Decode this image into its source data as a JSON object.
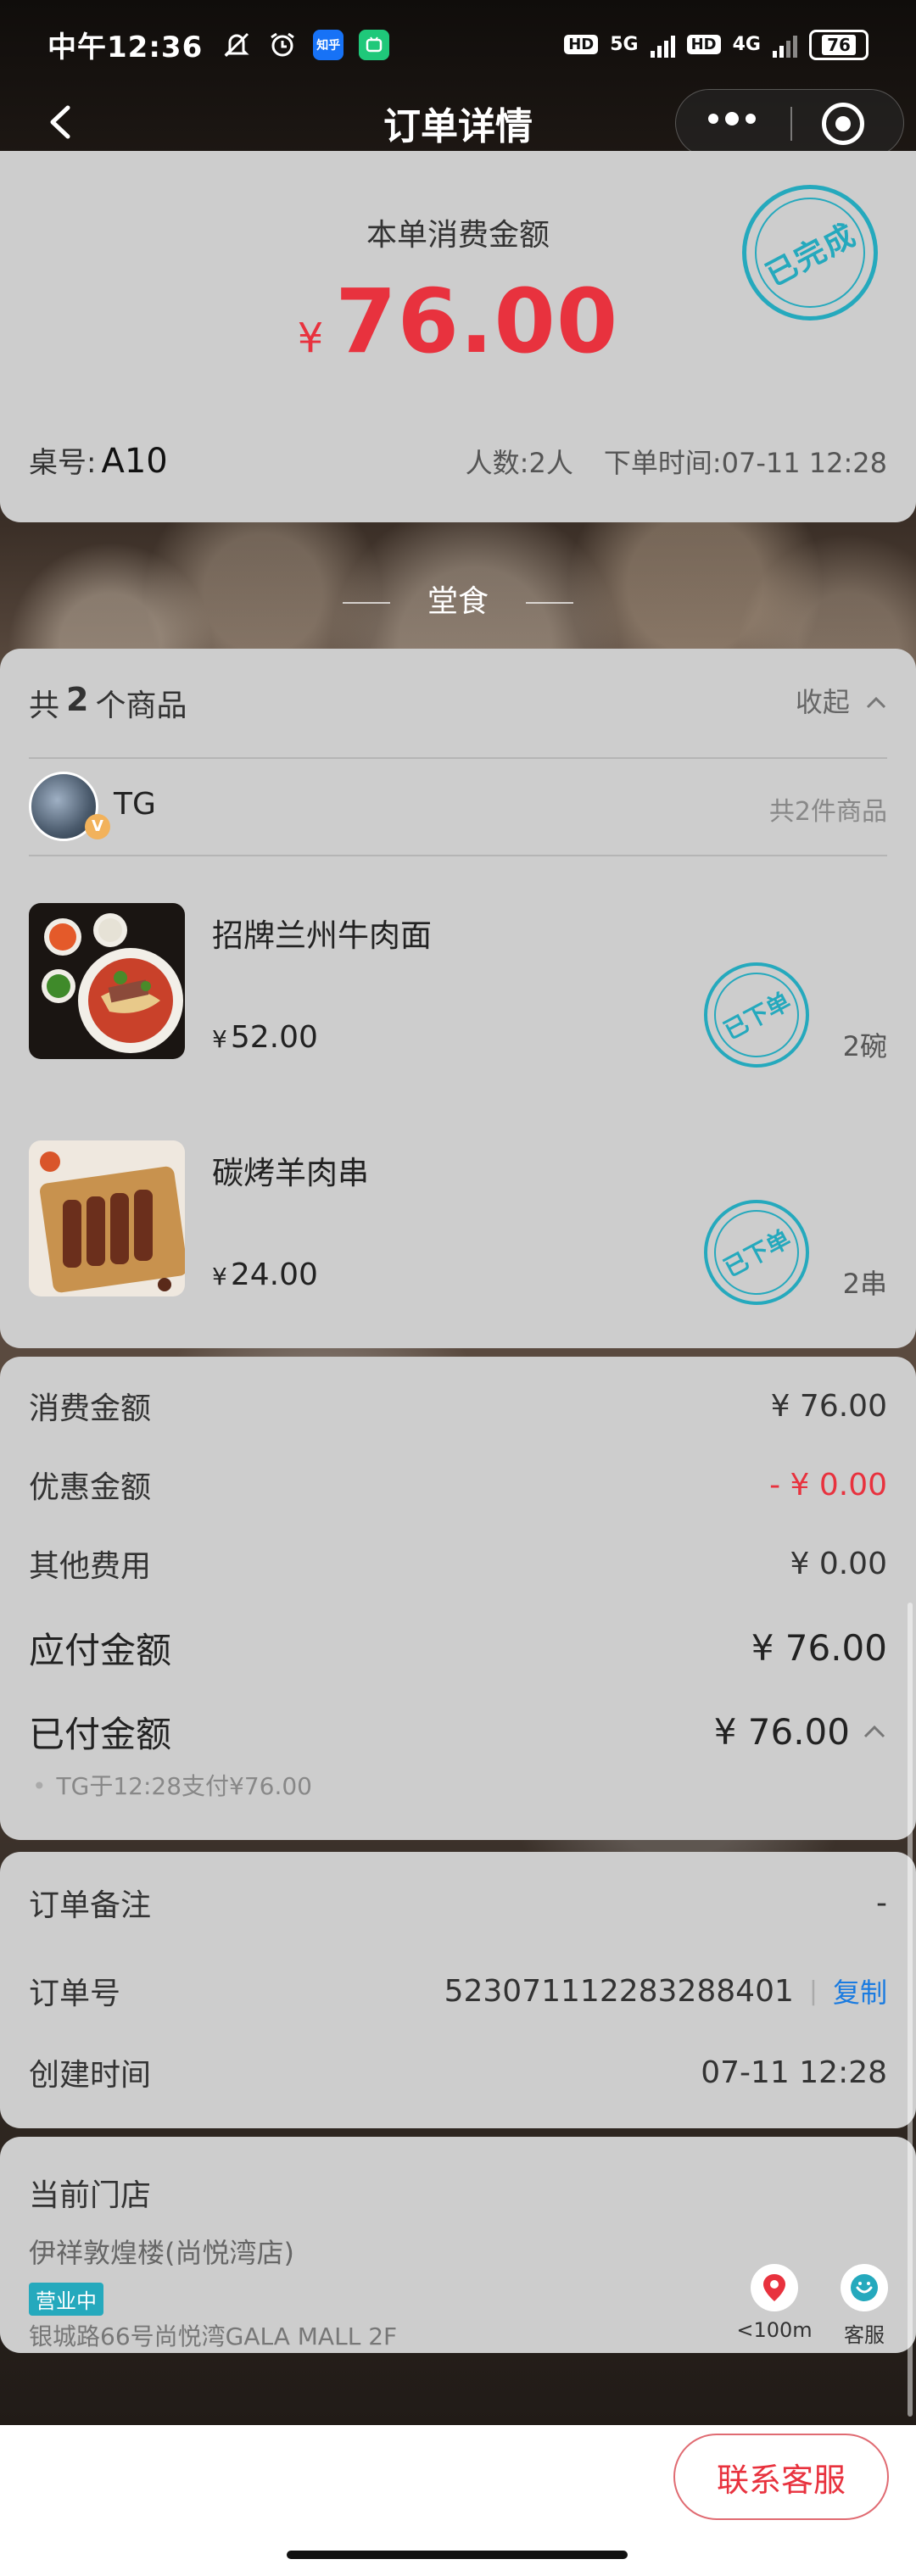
{
  "status_bar": {
    "time": "中午12:36",
    "battery": "76",
    "net1": "5G",
    "net2": "4G",
    "hd": "HD",
    "app_zhihu": "知乎"
  },
  "nav": {
    "title": "订单详情"
  },
  "summary": {
    "label": "本单消费金额",
    "currency": "¥",
    "amount": "76.00",
    "stamp": "已完成",
    "table_label": "桌号:",
    "table_value": "A10",
    "people": "人数:2人",
    "order_time": "下单时间:07-11 12:28"
  },
  "dine_type": "堂食",
  "items_section": {
    "prefix": "共",
    "count": "2",
    "suffix": "个商品",
    "collapse_label": "收起",
    "user": {
      "name": "TG",
      "badge": "V",
      "item_count": "共2件商品"
    },
    "dishes": [
      {
        "name": "招牌兰州牛肉面",
        "price": "52.00",
        "currency": "¥",
        "qty": "2碗",
        "stamp": "已下单"
      },
      {
        "name": "碳烤羊肉串",
        "price": "24.00",
        "currency": "¥",
        "qty": "2串",
        "stamp": "已下单"
      }
    ]
  },
  "amounts": {
    "consume": {
      "label": "消费金额",
      "value": "¥ 76.00"
    },
    "discount": {
      "label": "优惠金额",
      "value": "- ¥ 0.00"
    },
    "other": {
      "label": "其他费用",
      "value": "¥ 0.00"
    },
    "payable": {
      "label": "应付金额",
      "value": "¥ 76.00"
    },
    "paid": {
      "label": "已付金额",
      "value": "¥ 76.00"
    },
    "pay_note": "TG于12:28支付¥76.00"
  },
  "order_info": {
    "remark": {
      "label": "订单备注",
      "value": "-"
    },
    "order_no": {
      "label": "订单号",
      "value": "523071112283288401",
      "separator": "|",
      "copy": "复制"
    },
    "created": {
      "label": "创建时间",
      "value": "07-11 12:28"
    }
  },
  "store": {
    "title": "当前门店",
    "name": "伊祥敦煌楼(尚悦湾店)",
    "status": "营业中",
    "address": "银城路66号尚悦湾GALA MALL 2F",
    "distance": "<100m",
    "service": "客服"
  },
  "bottom": {
    "contact": "联系客服"
  },
  "colors": {
    "accent_red": "#e8323e",
    "stamp_teal": "#25a9bd",
    "link_blue": "#1a7be0"
  }
}
